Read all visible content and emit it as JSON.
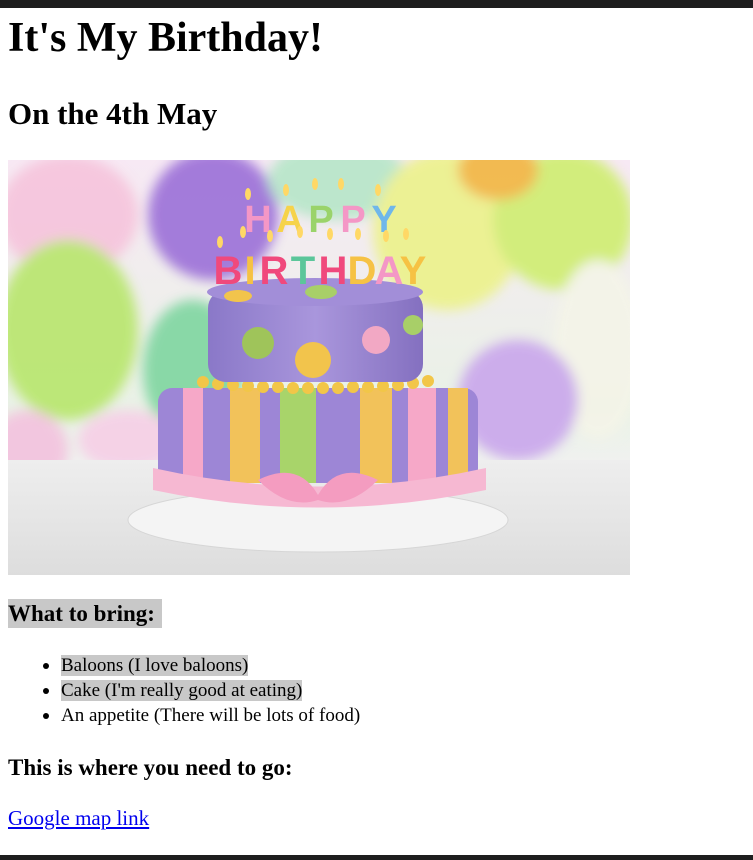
{
  "page": {
    "title": "It's My Birthday!",
    "subtitle": "On the 4th May"
  },
  "image": {
    "alt_lettering": "HAPPY BIRTHDAY"
  },
  "bring": {
    "heading": "What to bring:",
    "items": [
      "Baloons (I love baloons)",
      "Cake (I'm really good at eating)",
      "An appetite (There will be lots of food)"
    ]
  },
  "location": {
    "heading": "This is where you need to go:",
    "link_text": "Google map link"
  },
  "colors": {
    "highlight": "#c8c8c8",
    "link": "#0000ee",
    "frame": "#1e1e1e"
  }
}
